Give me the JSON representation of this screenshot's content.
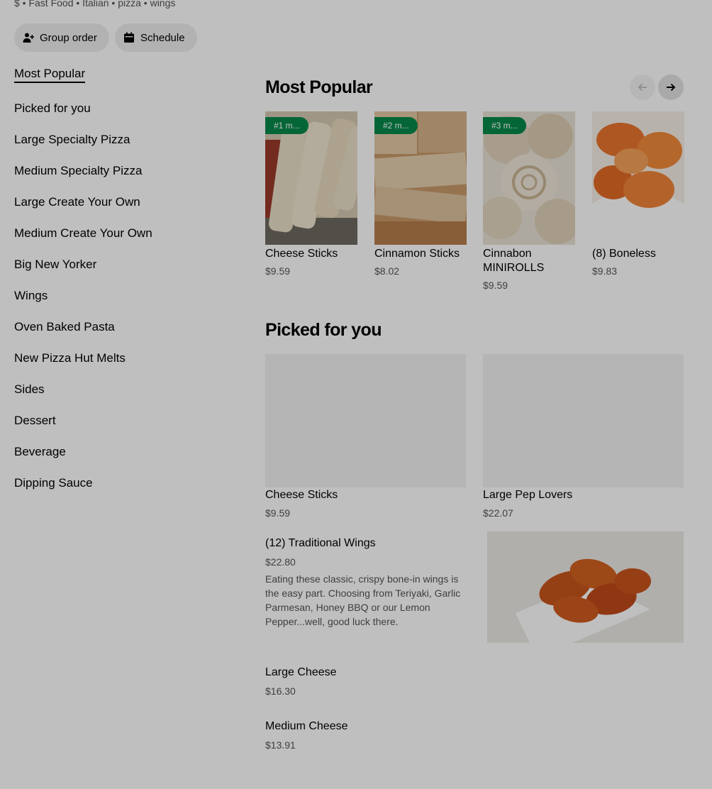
{
  "header": {
    "tagline": "$ • Fast Food • Italian • pizza • wings",
    "group_order_label": "Group order",
    "schedule_label": "Schedule"
  },
  "sidebar": {
    "items": [
      {
        "label": "Most Popular",
        "active": true
      },
      {
        "label": "Picked for you"
      },
      {
        "label": "Large Specialty Pizza"
      },
      {
        "label": "Medium Specialty Pizza"
      },
      {
        "label": "Large Create Your Own"
      },
      {
        "label": "Medium Create Your Own"
      },
      {
        "label": "Big New Yorker"
      },
      {
        "label": "Wings"
      },
      {
        "label": "Oven Baked Pasta"
      },
      {
        "label": "New Pizza Hut Melts"
      },
      {
        "label": "Sides"
      },
      {
        "label": "Dessert"
      },
      {
        "label": "Beverage"
      },
      {
        "label": "Dipping Sauce"
      }
    ]
  },
  "popular": {
    "title": "Most Popular",
    "items": [
      {
        "badge": "#1 m...",
        "name": "Cheese Sticks",
        "price": "$9.59"
      },
      {
        "badge": "#2 m...",
        "name": "Cinnamon Sticks",
        "price": "$8.02"
      },
      {
        "badge": "#3 m...",
        "name": "Cinnabon MINIROLLS",
        "price": "$9.59"
      },
      {
        "name": "(8) Boneless",
        "price": "$9.83"
      }
    ]
  },
  "picked": {
    "title": "Picked for you",
    "cards": [
      {
        "name": "Cheese Sticks",
        "price": "$9.59"
      },
      {
        "name": "Large Pep Lovers",
        "price": "$22.07"
      }
    ],
    "rows": [
      {
        "name": "(12) Traditional Wings",
        "price": "$22.80",
        "description": "Eating these classic, crispy bone-in wings is the easy part. Choosing from Teriyaki, Garlic Parmesan, Honey BBQ or our Lemon Pepper...well, good luck there."
      },
      {
        "name": "Large Cheese",
        "price": "$16.30"
      },
      {
        "name": "Medium Cheese",
        "price": "$13.91"
      }
    ]
  },
  "icons": {
    "group_order": "person-add-icon",
    "schedule": "calendar-icon",
    "carousel_prev": "arrow-left-icon",
    "carousel_next": "arrow-right-icon"
  },
  "colors": {
    "badge_green": "#06894a",
    "text_primary": "#000000",
    "text_secondary": "#545454",
    "pill_bg": "#eeeeee",
    "modal_overlay": "#000000"
  }
}
